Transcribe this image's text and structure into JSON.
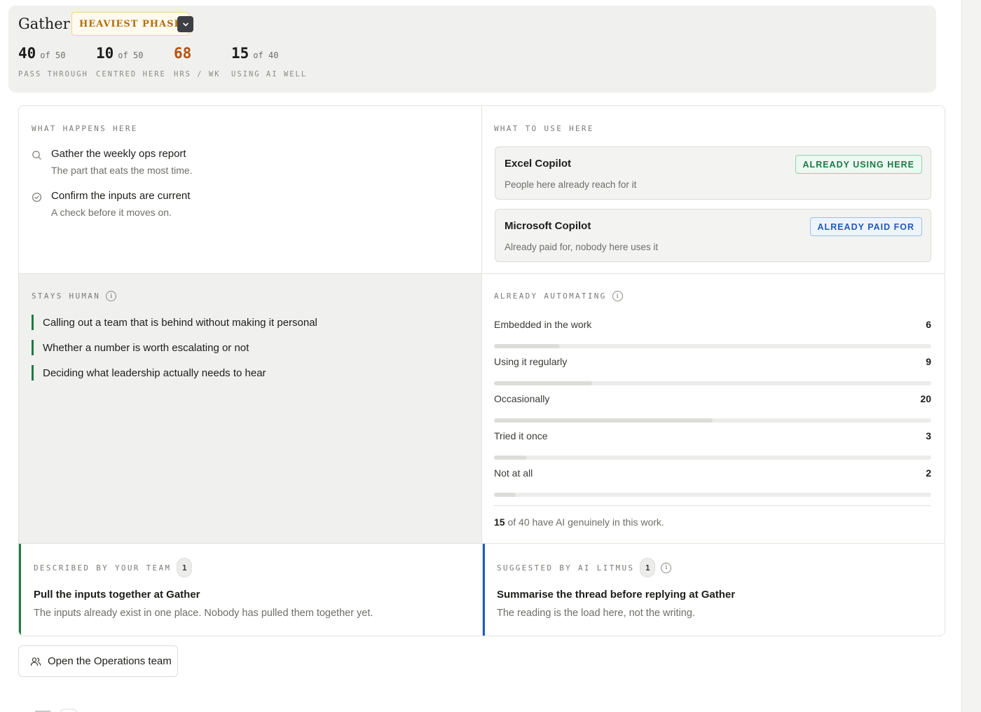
{
  "phase": {
    "title": "Gather",
    "badge": "HEAVIEST PHASE",
    "stats": [
      {
        "value": "40",
        "of": "of 50",
        "label": "PASS THROUGH"
      },
      {
        "value": "10",
        "of": "of 50",
        "label": "CENTRED HERE"
      },
      {
        "value": "68",
        "of": "",
        "label": "HRS / WK"
      },
      {
        "value": "15",
        "of": "of 40",
        "label": "USING AI WELL"
      }
    ],
    "highlight_color": "#b5520f"
  },
  "what_happens": {
    "label": "WHAT HAPPENS HERE",
    "steps": [
      {
        "icon": "search-icon",
        "title": "Gather the weekly ops report",
        "subtitle": "The part that eats the most time."
      },
      {
        "icon": "check-circle-icon",
        "title": "Confirm the inputs are current",
        "subtitle": "A check before it moves on."
      }
    ]
  },
  "what_to_use": {
    "label": "WHAT TO USE HERE",
    "tools": [
      {
        "name": "Excel Copilot",
        "description": "People here already reach for it",
        "badge": "ALREADY USING HERE",
        "badge_color": "#1e7a45"
      },
      {
        "name": "Microsoft Copilot",
        "description": "Already paid for, nobody here uses it",
        "badge": "ALREADY PAID FOR",
        "badge_color": "#2159b8"
      }
    ]
  },
  "stays_human": {
    "label": "STAYS HUMAN",
    "items": [
      "Calling out a team that is behind without making it personal",
      "Whether a number is worth escalating or not",
      "Deciding what leadership actually needs to hear"
    ]
  },
  "already_automating": {
    "label": "ALREADY AUTOMATING",
    "rows": [
      {
        "label": "Embedded in the work",
        "count": "6",
        "value": 6
      },
      {
        "label": "Using it regularly",
        "count": "9",
        "value": 9
      },
      {
        "label": "Occasionally",
        "count": "20",
        "value": 20
      },
      {
        "label": "Tried it once",
        "count": "3",
        "value": 3
      },
      {
        "label": "Not at all",
        "count": "2",
        "value": 2
      }
    ],
    "total": 40,
    "summary_count": "15",
    "summary_text": "of 40 have AI genuinely in this work."
  },
  "described_by_team": {
    "label": "DESCRIBED BY YOUR TEAM",
    "count": "1",
    "title": "Pull the inputs together at Gather",
    "description": "The inputs already exist in one place. Nobody has pulled them together yet.",
    "accent": "#1e7a45"
  },
  "suggested_by_ai": {
    "label": "SUGGESTED BY AI LITMUS",
    "count": "1",
    "title": "Summarise the thread before replying at Gather",
    "description": "The reading is the load here, not the writing.",
    "accent": "#2159b8"
  },
  "open_team_button": {
    "icon": "users-icon",
    "label": "Open the Operations team"
  }
}
